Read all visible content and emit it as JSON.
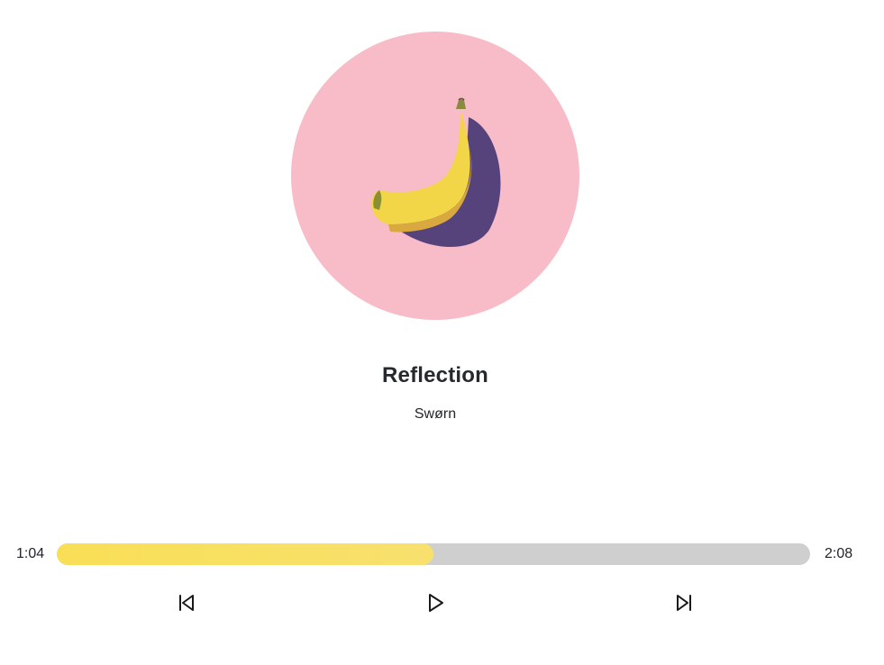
{
  "player": {
    "track": {
      "title": "Reflection",
      "artist": "Swørn",
      "album_art": "banana-on-pink-artwork"
    },
    "time": {
      "current": "1:04",
      "total": "2:08"
    },
    "progress_fraction": 0.5,
    "colors": {
      "progress_fill": "#f9df56",
      "progress_track": "#cfcfcf",
      "artwork_background": "#f7bcc8",
      "banana": "#f3d548",
      "shadow": "#57437c"
    },
    "controls": {
      "previous_icon": "skip-previous-icon",
      "play_icon": "play-icon",
      "next_icon": "skip-next-icon"
    }
  }
}
